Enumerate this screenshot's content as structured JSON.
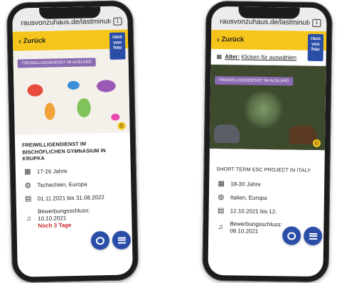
{
  "browser": {
    "url": "rausvonzuhaus.de/lastminute",
    "tab_count": "1"
  },
  "nav": {
    "back_label": "Zurück"
  },
  "logo": {
    "lines": [
      "raus",
      "von",
      "hau"
    ]
  },
  "filter": {
    "label": "Alter:",
    "link": "Klicken für auswählen"
  },
  "left_card": {
    "badge": "FREIWILLIGENDIENST IM AUSLAND",
    "title": "FREIWILLIGENDIENST IM BISCHÖFLICHEN GYMNASIUM IN KRUPKA",
    "age": "17-26 Jahre",
    "location": "Tschechien, Europa",
    "dates": "01.11.2021 bis 31.08.2022",
    "deadline_label": "Bewerbungsschluss:",
    "deadline_date": "10.10.2021",
    "remaining": "Noch 3 Tage"
  },
  "right_card": {
    "badge": "FREIWILLIGENDIENST IM AUSLAND",
    "title": "SHORT TERM ESC PROJECT IN ITALY",
    "age": "18-30 Jahre",
    "location": "Italien, Europa",
    "dates": "12.10.2021 bis 12.",
    "deadline_label": "Bewerbungsschluss:",
    "deadline_date": "08.10.2021"
  },
  "icons": {
    "age": "calendar-grid-icon",
    "location": "globe-icon",
    "dates": "calendar-icon",
    "deadline": "bell-icon"
  },
  "colors": {
    "accent_yellow": "#f6c51b",
    "brand_blue": "#2a4ea8",
    "badge_purple": "#8a6ab0",
    "alert_red": "#cc2a2a"
  }
}
